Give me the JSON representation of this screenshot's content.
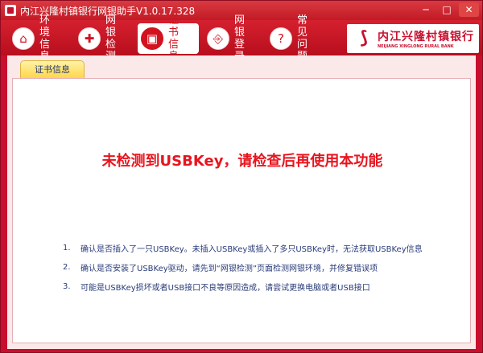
{
  "window": {
    "title": "内江兴隆村镇银行网银助手V1.0.17.328",
    "minimize": "─",
    "maximize": "□",
    "close": "✕"
  },
  "nav": {
    "items": [
      {
        "label": "环 境\n信 息",
        "icon": "⌂",
        "icon_name": "home-icon"
      },
      {
        "label": "网 银\n检 测",
        "icon": "✚",
        "icon_name": "stethoscope-icon"
      },
      {
        "label": "证 书\n信 息",
        "icon": "▣",
        "icon_name": "certificate-icon",
        "active": true
      },
      {
        "label": "网 银\n登 录",
        "icon": "⎆",
        "icon_name": "login-icon"
      },
      {
        "label": "常 见\n问 题",
        "icon": "?",
        "icon_name": "question-icon"
      }
    ]
  },
  "logo": {
    "mark": "⟆",
    "name_cn": "内江兴隆村镇银行",
    "name_en": "NEIJIANG XINGLONG RURAL BANK"
  },
  "tab": {
    "label": "证书信息"
  },
  "main": {
    "warning": "未检测到USBKey，请检查后再使用本功能",
    "tips": [
      {
        "num": "1.",
        "text": "确认是否插入了一只USBKey。未插入USBKey或插入了多只USBKey时，无法获取USBKey信息"
      },
      {
        "num": "2.",
        "text": "确认是否安装了USBKey驱动，请先到“网银检测”页面检测网银环境，并修复错误项"
      },
      {
        "num": "3.",
        "text": "可能是USBKey损坏或者USB接口不良等原因造成，请尝试更换电脑或者USB接口"
      }
    ]
  },
  "colors": {
    "brand_red": "#c8102e",
    "warning_red": "#e8141e",
    "tip_text": "#2a3c7a",
    "tab_yellow": "#ffd64a"
  }
}
